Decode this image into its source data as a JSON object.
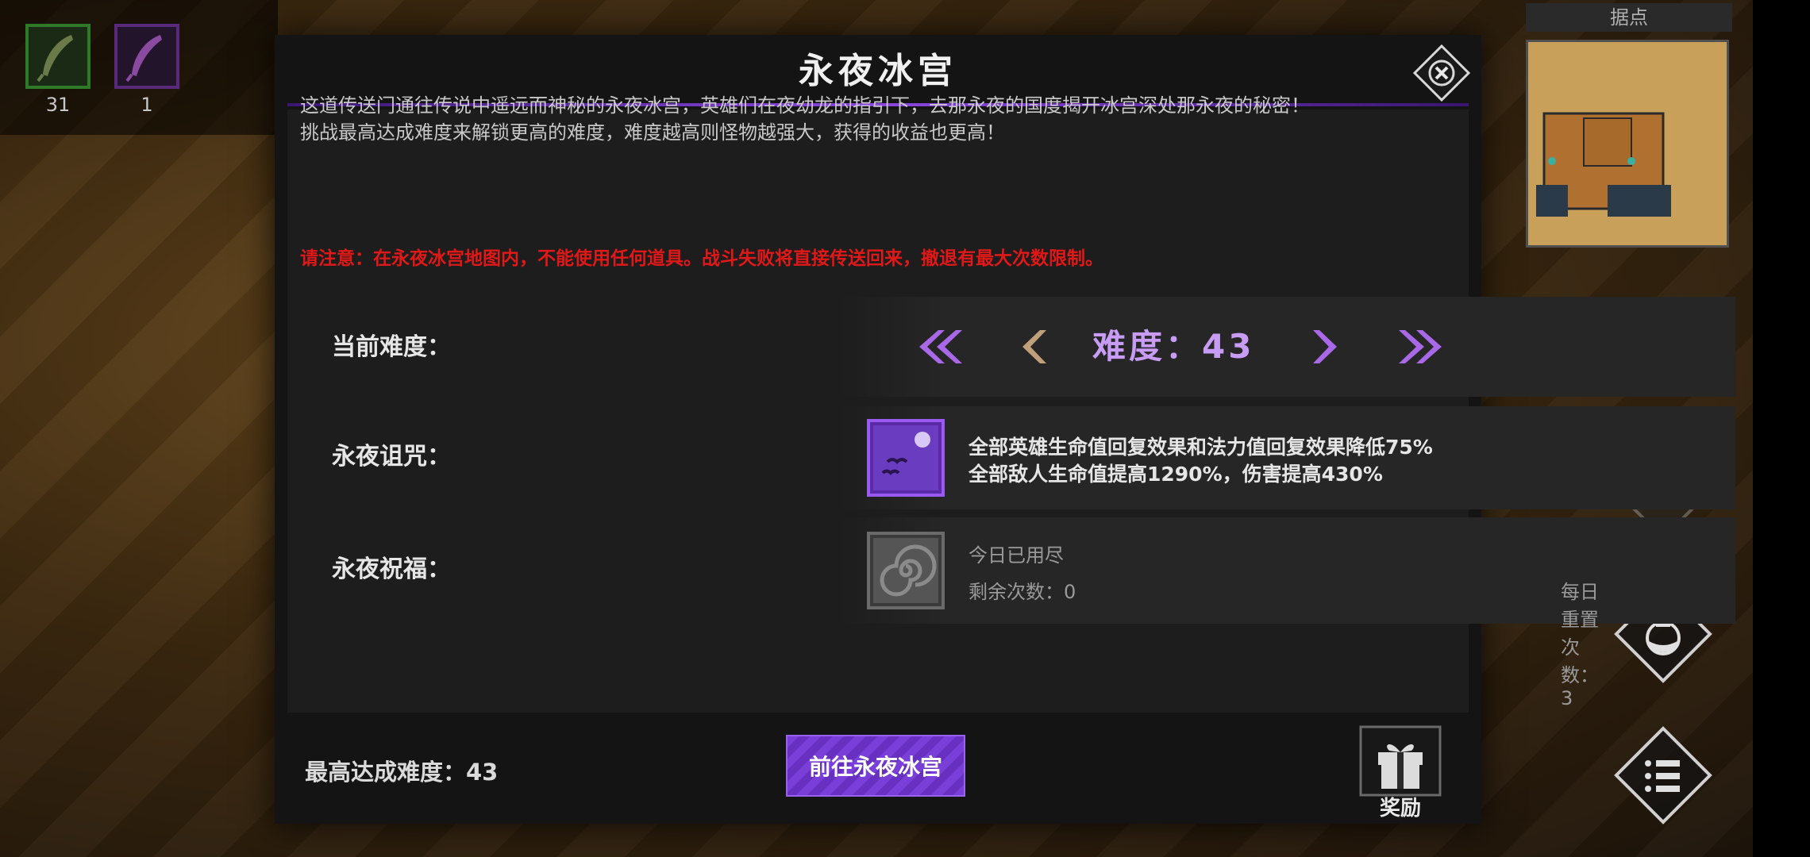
{
  "resources": [
    {
      "icon": "green-feather-icon",
      "count": "31"
    },
    {
      "icon": "purple-feather-icon",
      "count": "1"
    }
  ],
  "minimap": {
    "title": "据点"
  },
  "modal": {
    "title": "永夜冰宫",
    "description_lines": [
      "这道传送门通往传说中遥远而神秘的永夜冰宫，英雄们在夜幼龙的指引下，去那永夜的国度揭开冰宫深处那永夜的秘密！",
      "挑战最高达成难度来解锁更高的难度，难度越高则怪物越强大，获得的收益也更高！"
    ],
    "warning": "请注意：在永夜冰宫地图内，不能使用任何道具。战斗失败将直接传送回来，撤退有最大次数限制。",
    "difficulty": {
      "label": "当前难度：",
      "value_text": "难度：43"
    },
    "curse": {
      "label": "永夜诅咒：",
      "lines": [
        "全部英雄生命值回复效果和法力值回复效果降低75%",
        "全部敌人生命值提高1290%，伤害提高430%"
      ]
    },
    "blessing": {
      "label": "永夜祝福：",
      "status": "今日已用尽",
      "remaining": "剩余次数：0",
      "daily_reset": "每日重置次数：3"
    },
    "max_difficulty": "最高达成难度：43",
    "go_button": "前往永夜冰宫",
    "reward_label": "奖励"
  },
  "colors": {
    "accent_purple": "#8a46e0",
    "difficulty_text": "#c89cf4",
    "warning_red": "#e01818"
  }
}
